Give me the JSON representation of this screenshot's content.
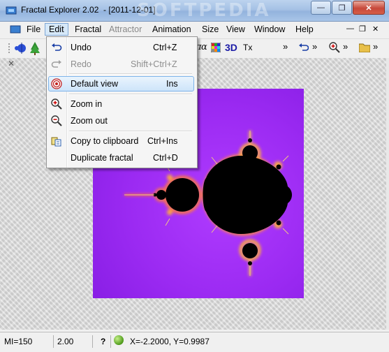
{
  "window": {
    "title": "Fractal Explorer 2.02  - [2011-12-01]",
    "watermark": "SOFTPEDIA",
    "minimize_symbol": "—",
    "restore_symbol": "❐",
    "close_symbol": "✕"
  },
  "menu": {
    "items": [
      {
        "label": "File"
      },
      {
        "label": "Edit"
      },
      {
        "label": "Fractal"
      },
      {
        "label": "Attractor"
      },
      {
        "label": "Animation"
      },
      {
        "label": "Size"
      },
      {
        "label": "View"
      },
      {
        "label": "Window"
      },
      {
        "label": "Help"
      }
    ],
    "mdi_controls": [
      "—",
      "❐",
      "✕"
    ]
  },
  "toolbar": {
    "label_3d": "3D",
    "label_tx": "Tx",
    "label_pi": "π",
    "label_alpha": "α",
    "overflow": "»"
  },
  "edit_menu": {
    "items": [
      {
        "label": "Undo",
        "shortcut": "Ctrl+Z",
        "icon": "undo-icon",
        "enabled": true
      },
      {
        "label": "Redo",
        "shortcut": "Shift+Ctrl+Z",
        "icon": "redo-icon",
        "enabled": false
      },
      {
        "label": "Default view",
        "shortcut": "Ins",
        "icon": "target-icon",
        "enabled": true,
        "highlighted": true
      },
      {
        "label": "Zoom in",
        "shortcut": "",
        "icon": "zoom-in-icon",
        "enabled": true
      },
      {
        "label": "Zoom out",
        "shortcut": "",
        "icon": "zoom-out-icon",
        "enabled": true
      },
      {
        "label": "Copy to clipboard",
        "shortcut": "Ctrl+Ins",
        "icon": "copy-icon",
        "enabled": true
      },
      {
        "label": "Duplicate fractal",
        "shortcut": "Ctrl+D",
        "icon": "",
        "enabled": true
      }
    ]
  },
  "status": {
    "iterations": "MI=150",
    "zoom": "2.00",
    "help": "?",
    "coords": "X=-2.2000, Y=0.9987"
  },
  "colors": {
    "fractal_background": "#9b2af2",
    "fractal_inner": "#000000",
    "fractal_edge": "#f2b23a"
  }
}
